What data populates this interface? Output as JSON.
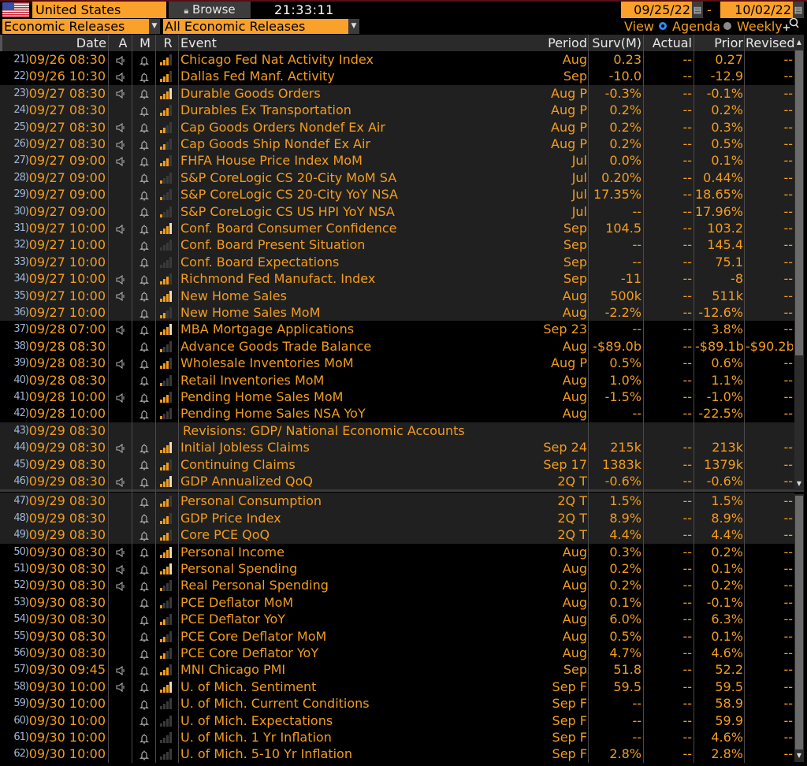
{
  "header": {
    "country": "United States",
    "browse_label": "Browse",
    "clock": "21:33:11",
    "start_date": "09/25/22",
    "end_date": "10/02/22",
    "date_separator": "-",
    "category_select": "Economic Releases",
    "filter_select": "All Economic Releases",
    "view_label": "View",
    "view_options": [
      {
        "label": "Agenda",
        "selected": true
      },
      {
        "label": "Weekly",
        "selected": false
      }
    ]
  },
  "columns": {
    "date_time": "Date Time",
    "a": "A",
    "m": "M",
    "r": "R",
    "event": "Event",
    "period": "Period",
    "surv": "Surv(M)",
    "actual": "Actual",
    "prior": "Prior",
    "revised": "Revised"
  },
  "colors": {
    "accent": "#f39c1e",
    "selector_bg": "#f9a12a",
    "row_alt": "#202020",
    "radio_selected": "#2d8ff0"
  },
  "rows": [
    {
      "num": "21)",
      "dt": "09/26 08:30",
      "alert": true,
      "rel": 3,
      "pale": false,
      "event": "Chicago Fed Nat Activity Index",
      "period": "Aug",
      "surv": "0.23",
      "actual": "--",
      "prior": "0.27",
      "revised": "--",
      "shade": "dark"
    },
    {
      "num": "22)",
      "dt": "09/26 10:30",
      "alert": true,
      "rel": 3,
      "pale": false,
      "event": "Dallas Fed Manf. Activity",
      "period": "Sep",
      "surv": "-10.0",
      "actual": "--",
      "prior": "-12.9",
      "revised": "--",
      "shade": "dark"
    },
    {
      "num": "23)",
      "dt": "09/27 08:30",
      "alert": true,
      "rel": 4,
      "pale": true,
      "event": "Durable Goods Orders",
      "period": "Aug P",
      "surv": "-0.3%",
      "actual": "--",
      "prior": "-0.1%",
      "revised": "--",
      "shade": "gray"
    },
    {
      "num": "24)",
      "dt": "09/27 08:30",
      "alert": false,
      "rel": 3,
      "pale": false,
      "event": "Durables Ex Transportation",
      "period": "Aug P",
      "surv": "0.2%",
      "actual": "--",
      "prior": "0.2%",
      "revised": "--",
      "shade": "gray"
    },
    {
      "num": "25)",
      "dt": "09/27 08:30",
      "alert": true,
      "rel": 2,
      "pale": false,
      "event": "Cap Goods Orders Nondef Ex Air",
      "period": "Aug P",
      "surv": "0.2%",
      "actual": "--",
      "prior": "0.3%",
      "revised": "--",
      "shade": "gray"
    },
    {
      "num": "26)",
      "dt": "09/27 08:30",
      "alert": true,
      "rel": 2,
      "pale": false,
      "event": "Cap Goods Ship Nondef Ex Air",
      "period": "Aug P",
      "surv": "0.2%",
      "actual": "--",
      "prior": "0.5%",
      "revised": "--",
      "shade": "gray"
    },
    {
      "num": "27)",
      "dt": "09/27 09:00",
      "alert": true,
      "rel": 3,
      "pale": false,
      "event": "FHFA House Price Index MoM",
      "period": "Jul",
      "surv": "0.0%",
      "actual": "--",
      "prior": "0.1%",
      "revised": "--",
      "shade": "gray"
    },
    {
      "num": "28)",
      "dt": "09/27 09:00",
      "alert": false,
      "rel": 1,
      "pale": false,
      "event": "S&P CoreLogic CS 20-City MoM SA",
      "period": "Jul",
      "surv": "0.20%",
      "actual": "--",
      "prior": "0.44%",
      "revised": "--",
      "shade": "gray"
    },
    {
      "num": "29)",
      "dt": "09/27 09:00",
      "alert": false,
      "rel": 1,
      "pale": false,
      "event": "S&P CoreLogic CS 20-City YoY NSA",
      "period": "Jul",
      "surv": "17.35%",
      "actual": "--",
      "prior": "18.65%",
      "revised": "--",
      "shade": "gray"
    },
    {
      "num": "30)",
      "dt": "09/27 09:00",
      "alert": false,
      "rel": 1,
      "pale": false,
      "event": "S&P CoreLogic CS US HPI YoY NSA",
      "period": "Jul",
      "surv": "--",
      "actual": "--",
      "prior": "17.96%",
      "revised": "--",
      "shade": "gray"
    },
    {
      "num": "31)",
      "dt": "09/27 10:00",
      "alert": true,
      "rel": 4,
      "pale": true,
      "event": "Conf. Board Consumer Confidence",
      "period": "Sep",
      "surv": "104.5",
      "actual": "--",
      "prior": "103.2",
      "revised": "--",
      "shade": "gray"
    },
    {
      "num": "32)",
      "dt": "09/27 10:00",
      "alert": false,
      "rel": 0,
      "pale": false,
      "event": "Conf. Board Present Situation",
      "period": "Sep",
      "surv": "--",
      "actual": "--",
      "prior": "145.4",
      "revised": "--",
      "shade": "gray"
    },
    {
      "num": "33)",
      "dt": "09/27 10:00",
      "alert": false,
      "rel": 0,
      "pale": false,
      "event": "Conf. Board Expectations",
      "period": "Sep",
      "surv": "--",
      "actual": "--",
      "prior": "75.1",
      "revised": "--",
      "shade": "gray"
    },
    {
      "num": "34)",
      "dt": "09/27 10:00",
      "alert": true,
      "rel": 3,
      "pale": false,
      "event": "Richmond Fed Manufact. Index",
      "period": "Sep",
      "surv": "-11",
      "actual": "--",
      "prior": "-8",
      "revised": "--",
      "shade": "gray"
    },
    {
      "num": "35)",
      "dt": "09/27 10:00",
      "alert": true,
      "rel": 4,
      "pale": true,
      "event": "New Home Sales",
      "period": "Aug",
      "surv": "500k",
      "actual": "--",
      "prior": "511k",
      "revised": "--",
      "shade": "gray"
    },
    {
      "num": "36)",
      "dt": "09/27 10:00",
      "alert": false,
      "rel": 2,
      "pale": false,
      "event": "New Home Sales MoM",
      "period": "Aug",
      "surv": "-2.2%",
      "actual": "--",
      "prior": "-12.6%",
      "revised": "--",
      "shade": "gray"
    },
    {
      "num": "37)",
      "dt": "09/28 07:00",
      "alert": true,
      "rel": 4,
      "pale": true,
      "event": "MBA Mortgage Applications",
      "period": "Sep 23",
      "surv": "--",
      "actual": "--",
      "prior": "3.8%",
      "revised": "--",
      "shade": "dark"
    },
    {
      "num": "38)",
      "dt": "09/28 08:30",
      "alert": false,
      "rel": 1,
      "pale": false,
      "event": "Advance Goods Trade Balance",
      "period": "Aug",
      "surv": "-$89.0b",
      "actual": "--",
      "prior": "-$89.1b",
      "revised": "-$90.2b",
      "shade": "dark"
    },
    {
      "num": "39)",
      "dt": "09/28 08:30",
      "alert": true,
      "rel": 3,
      "pale": false,
      "event": "Wholesale Inventories MoM",
      "period": "Aug P",
      "surv": "0.5%",
      "actual": "--",
      "prior": "0.6%",
      "revised": "--",
      "shade": "dark"
    },
    {
      "num": "40)",
      "dt": "09/28 08:30",
      "alert": false,
      "rel": 1,
      "pale": false,
      "event": "Retail Inventories MoM",
      "period": "Aug",
      "surv": "1.0%",
      "actual": "--",
      "prior": "1.1%",
      "revised": "--",
      "shade": "dark"
    },
    {
      "num": "41)",
      "dt": "09/28 10:00",
      "alert": true,
      "rel": 3,
      "pale": false,
      "event": "Pending Home Sales MoM",
      "period": "Aug",
      "surv": "-1.5%",
      "actual": "--",
      "prior": "-1.0%",
      "revised": "--",
      "shade": "dark"
    },
    {
      "num": "42)",
      "dt": "09/28 10:00",
      "alert": false,
      "rel": 1,
      "pale": false,
      "event": "Pending Home Sales NSA YoY",
      "period": "Aug",
      "surv": "--",
      "actual": "--",
      "prior": "-22.5%",
      "revised": "--",
      "shade": "dark"
    },
    {
      "num": "43)",
      "dt": "09/29 08:30",
      "alert": false,
      "bell": false,
      "rel": -1,
      "pale": false,
      "event": "Revisions: GDP/ National Economic Accounts",
      "period": "",
      "surv": "",
      "actual": "",
      "prior": "",
      "revised": "",
      "shade": "gray",
      "section": true
    },
    {
      "num": "44)",
      "dt": "09/29 08:30",
      "alert": true,
      "rel": 4,
      "pale": true,
      "event": "Initial Jobless Claims",
      "period": "Sep 24",
      "surv": "215k",
      "actual": "--",
      "prior": "213k",
      "revised": "--",
      "shade": "gray"
    },
    {
      "num": "45)",
      "dt": "09/29 08:30",
      "alert": false,
      "rel": 3,
      "pale": false,
      "event": "Continuing Claims",
      "period": "Sep 17",
      "surv": "1383k",
      "actual": "--",
      "prior": "1379k",
      "revised": "--",
      "shade": "gray"
    },
    {
      "num": "46)",
      "dt": "09/29 08:30",
      "alert": true,
      "rel": 4,
      "pale": true,
      "event": "GDP Annualized QoQ",
      "period": "2Q T",
      "surv": "-0.6%",
      "actual": "--",
      "prior": "-0.6%",
      "revised": "--",
      "shade": "gray"
    },
    {
      "num": "47)",
      "dt": "09/29 08:30",
      "alert": false,
      "rel": 3,
      "pale": false,
      "event": "Personal Consumption",
      "period": "2Q T",
      "surv": "1.5%",
      "actual": "--",
      "prior": "1.5%",
      "revised": "--",
      "shade": "gray"
    },
    {
      "num": "48)",
      "dt": "09/29 08:30",
      "alert": false,
      "rel": 3,
      "pale": false,
      "event": "GDP Price Index",
      "period": "2Q T",
      "surv": "8.9%",
      "actual": "--",
      "prior": "8.9%",
      "revised": "--",
      "shade": "gray"
    },
    {
      "num": "49)",
      "dt": "09/29 08:30",
      "alert": false,
      "rel": 3,
      "pale": false,
      "event": "Core PCE QoQ",
      "period": "2Q T",
      "surv": "4.4%",
      "actual": "--",
      "prior": "4.4%",
      "revised": "--",
      "shade": "gray"
    },
    {
      "num": "50)",
      "dt": "09/30 08:30",
      "alert": true,
      "rel": 4,
      "pale": true,
      "event": "Personal Income",
      "period": "Aug",
      "surv": "0.3%",
      "actual": "--",
      "prior": "0.2%",
      "revised": "--",
      "shade": "dark"
    },
    {
      "num": "51)",
      "dt": "09/30 08:30",
      "alert": true,
      "rel": 4,
      "pale": true,
      "event": "Personal Spending",
      "period": "Aug",
      "surv": "0.2%",
      "actual": "--",
      "prior": "0.1%",
      "revised": "--",
      "shade": "dark"
    },
    {
      "num": "52)",
      "dt": "09/30 08:30",
      "alert": true,
      "rel": 1,
      "pale": false,
      "event": "Real Personal Spending",
      "period": "Aug",
      "surv": "0.2%",
      "actual": "--",
      "prior": "0.2%",
      "revised": "--",
      "shade": "dark"
    },
    {
      "num": "53)",
      "dt": "09/30 08:30",
      "alert": false,
      "rel": 1,
      "pale": false,
      "event": "PCE Deflator MoM",
      "period": "Aug",
      "surv": "0.1%",
      "actual": "--",
      "prior": "-0.1%",
      "revised": "--",
      "shade": "dark"
    },
    {
      "num": "54)",
      "dt": "09/30 08:30",
      "alert": false,
      "rel": 2,
      "pale": false,
      "event": "PCE Deflator YoY",
      "period": "Aug",
      "surv": "6.0%",
      "actual": "--",
      "prior": "6.3%",
      "revised": "--",
      "shade": "dark"
    },
    {
      "num": "55)",
      "dt": "09/30 08:30",
      "alert": false,
      "rel": 2,
      "pale": false,
      "event": "PCE Core Deflator MoM",
      "period": "Aug",
      "surv": "0.5%",
      "actual": "--",
      "prior": "0.1%",
      "revised": "--",
      "shade": "dark"
    },
    {
      "num": "56)",
      "dt": "09/30 08:30",
      "alert": false,
      "rel": 2,
      "pale": false,
      "event": "PCE Core Deflator YoY",
      "period": "Aug",
      "surv": "4.7%",
      "actual": "--",
      "prior": "4.6%",
      "revised": "--",
      "shade": "dark"
    },
    {
      "num": "57)",
      "dt": "09/30 09:45",
      "alert": true,
      "rel": 3,
      "pale": false,
      "event": "MNI Chicago PMI",
      "period": "Sep",
      "surv": "51.8",
      "actual": "--",
      "prior": "52.2",
      "revised": "--",
      "shade": "dark"
    },
    {
      "num": "58)",
      "dt": "09/30 10:00",
      "alert": true,
      "rel": 4,
      "pale": true,
      "event": "U. of Mich. Sentiment",
      "period": "Sep F",
      "surv": "59.5",
      "actual": "--",
      "prior": "59.5",
      "revised": "--",
      "shade": "dark"
    },
    {
      "num": "59)",
      "dt": "09/30 10:00",
      "alert": false,
      "rel": 0,
      "pale": false,
      "event": "U. of Mich. Current Conditions",
      "period": "Sep F",
      "surv": "--",
      "actual": "--",
      "prior": "58.9",
      "revised": "--",
      "shade": "dark"
    },
    {
      "num": "60)",
      "dt": "09/30 10:00",
      "alert": false,
      "rel": 0,
      "pale": false,
      "event": "U. of Mich. Expectations",
      "period": "Sep F",
      "surv": "--",
      "actual": "--",
      "prior": "59.9",
      "revised": "--",
      "shade": "dark"
    },
    {
      "num": "61)",
      "dt": "09/30 10:00",
      "alert": false,
      "rel": 0,
      "pale": false,
      "event": "U. of Mich. 1 Yr Inflation",
      "period": "Sep F",
      "surv": "--",
      "actual": "--",
      "prior": "4.6%",
      "revised": "--",
      "shade": "dark"
    },
    {
      "num": "62)",
      "dt": "09/30 10:00",
      "alert": false,
      "rel": 0,
      "pale": false,
      "event": "U. of Mich. 5-10 Yr Inflation",
      "period": "Sep F",
      "surv": "2.8%",
      "actual": "--",
      "prior": "2.8%",
      "revised": "--",
      "shade": "dark"
    }
  ]
}
